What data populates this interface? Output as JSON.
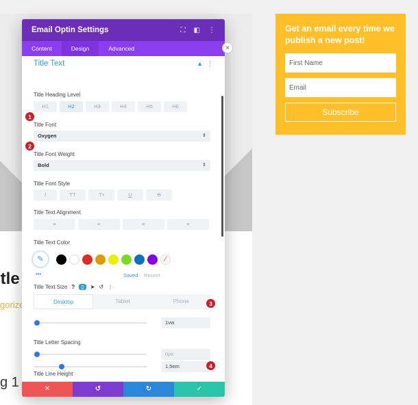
{
  "background": {
    "title_fragment": "itle",
    "category_fragment": "gorize",
    "post_fragment": "g 1"
  },
  "optin": {
    "heading": "Get an email every time we publish a new post!",
    "first_name_placeholder": "First Name",
    "email_placeholder": "Email",
    "subscribe_label": "Subscribe"
  },
  "modal": {
    "title": "Email Optin Settings",
    "tabs": [
      "Content",
      "Design",
      "Advanced"
    ],
    "active_tab": "Design",
    "section_title": "Title Text",
    "heading_level": {
      "label": "Title Heading Level",
      "options": [
        "H1",
        "H2",
        "H3",
        "H4",
        "H5",
        "H6"
      ],
      "selected": "H2"
    },
    "font": {
      "label": "Title Font",
      "value": "Oxygen"
    },
    "weight": {
      "label": "Title Font Weight",
      "value": "Bold"
    },
    "style": {
      "label": "Title Font Style",
      "options": [
        "I",
        "TT",
        "Tт",
        "U",
        "S"
      ]
    },
    "alignment": {
      "label": "Title Text Alignment"
    },
    "color": {
      "label": "Title Text Color",
      "swatches": [
        "#000000",
        "#ffffff",
        "#e02b20",
        "#e09900",
        "#edf000",
        "#7cda24",
        "#0c71c3",
        "#8300e9"
      ],
      "saved_label": "Saved",
      "recent_label": "Recent",
      "more": "•••"
    },
    "size": {
      "label": "Title Text Size",
      "devices": [
        "Desktop",
        "Tablet",
        "Phone"
      ],
      "value": "1vw",
      "slider_fraction": 0.03
    },
    "letter_spacing": {
      "label": "Title Letter Spacing",
      "value": "0px",
      "slider_fraction": 0.03
    },
    "line_height": {
      "label": "Title Line Height",
      "value": "1.5em",
      "slider_fraction": 0.25
    },
    "badges": [
      "1",
      "2",
      "3",
      "4"
    ],
    "footer": {
      "cancel": "✕",
      "undo": "↺",
      "redo": "↻",
      "save": "✓"
    },
    "colors": {
      "header": "#6c2eb9",
      "tabs": "#8a3ef0",
      "accent": "#2e9bd8",
      "badge": "#cf1d25",
      "cancel": "#ef5555",
      "undo": "#7e3bd0",
      "redo": "#2b87da",
      "save": "#29c4a9"
    }
  }
}
